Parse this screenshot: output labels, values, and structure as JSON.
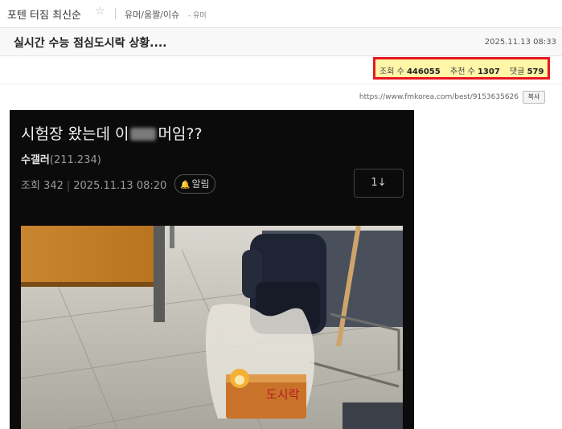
{
  "header": {
    "board_title": "포텐 터짐 최신순",
    "star": "☆",
    "category": "유머/움짤/이슈",
    "category_sub": "- 유머"
  },
  "post": {
    "title": "실시간 수능 점심도시락 상황....",
    "date": "2025.11.13 08:33"
  },
  "stats": {
    "views_label": "조회 수",
    "views": "446055",
    "recommends_label": "추천 수",
    "recommends": "1307",
    "comments_label": "댓글",
    "comments": "579"
  },
  "link": {
    "url": "https://www.fmkorea.com/best/9153635626",
    "copy_label": "복사"
  },
  "embedded": {
    "title_before": "시험장 왔는데 이",
    "title_after": "머임??",
    "author": "수갤러",
    "author_score": "(211.234)",
    "views": "조회 342",
    "date": "2025.11.13 08:20",
    "alarm_label": "알림",
    "sort_label": "1↓",
    "bag_text": "도시락"
  },
  "colors": {
    "highlight_border": "#e8171f",
    "highlight_bg": "#fff6a8",
    "embed_bg": "#0b0b0b"
  }
}
